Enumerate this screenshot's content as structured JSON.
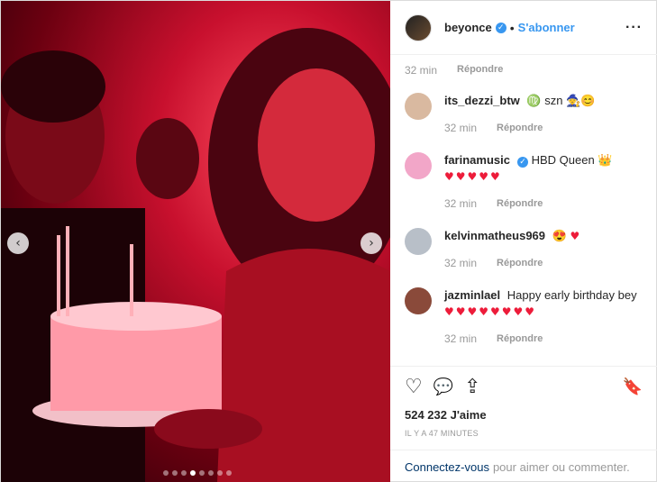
{
  "photo": {
    "prev_icon": "chevron-left-icon",
    "next_icon": "chevron-right-icon",
    "dot_count": 8,
    "active_dot": 3
  },
  "header": {
    "username": "beyonce",
    "verified_icon": "✓",
    "separator": "•",
    "follow_label": "S'abonner",
    "more_icon": "···"
  },
  "first_meta": {
    "time": "32 min",
    "reply": "Répondre"
  },
  "comments": [
    {
      "user": "its_dezzi_btw",
      "text": "♍ szn 🧙😊",
      "hearts": "",
      "time": "32 min",
      "reply": "Répondre",
      "avatar_color": "#d9b9a0"
    },
    {
      "user": "farinamusic",
      "verified": true,
      "text": "HBD Queen 👑",
      "hearts": "♥♥♥♥♥",
      "time": "32 min",
      "reply": "Répondre",
      "avatar_color": "#f2a6c8"
    },
    {
      "user": "kelvinmatheus969",
      "text": "😍",
      "hearts": "♥",
      "time": "32 min",
      "reply": "Répondre",
      "avatar_color": "#b8bfc8"
    },
    {
      "user": "jazminlael",
      "text": "Happy early birthday bey",
      "hearts": "♥♥♥♥♥♥♥♥",
      "time": "32 min",
      "reply": "Répondre",
      "avatar_color": "#8a4a3a"
    }
  ],
  "actions": {
    "like_icon": "♡",
    "comment_icon": "💬",
    "share_icon": "⇪",
    "save_icon": "🔖",
    "likes": "524 232 J'aime",
    "timestamp": "IL Y A 47 MINUTES"
  },
  "login": {
    "link": "Connectez-vous",
    "text": "pour aimer ou commenter."
  },
  "colors": {
    "accent": "#3897f0",
    "heart": "#ed1c3a",
    "photo_red": "#c8102e"
  }
}
